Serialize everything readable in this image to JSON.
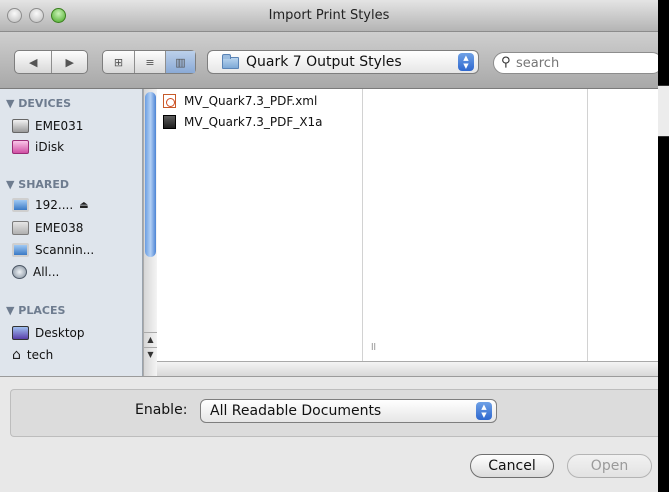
{
  "window": {
    "title": "Import Print Styles"
  },
  "toolbar": {
    "nav": {
      "back": "◀",
      "forward": "▶"
    },
    "views": {
      "icon": "⊞",
      "list": "≡",
      "column": "▥"
    },
    "location": "Quark 7 Output Styles",
    "search_placeholder": "search"
  },
  "sidebar": {
    "sections": [
      {
        "label": "▼ DEVICES",
        "items": [
          {
            "label": "EME031",
            "icon": "hard-drive-icon"
          },
          {
            "label": "iDisk",
            "icon": "idisk-icon"
          }
        ]
      },
      {
        "label": "▼ SHARED",
        "items": [
          {
            "label": "192....",
            "icon": "network-screen-icon",
            "eject": "⏏"
          },
          {
            "label": "EME038",
            "icon": "server-icon"
          },
          {
            "label": "Scannin...",
            "icon": "network-screen-icon"
          },
          {
            "label": "All...",
            "icon": "globe-icon"
          }
        ]
      },
      {
        "label": "▼ PLACES",
        "items": [
          {
            "label": "Desktop",
            "icon": "desktop-icon"
          },
          {
            "label": "tech",
            "icon": "home-icon"
          }
        ]
      }
    ]
  },
  "files": [
    {
      "name": "MV_Quark7.3_PDF.xml",
      "icon": "xml-file-icon"
    },
    {
      "name": "MV_Quark7.3_PDF_X1a",
      "icon": "document-file-icon"
    }
  ],
  "bottom": {
    "enable_label": "Enable:",
    "enable_value": "All Readable Documents",
    "cancel_label": "Cancel",
    "open_label": "Open"
  }
}
